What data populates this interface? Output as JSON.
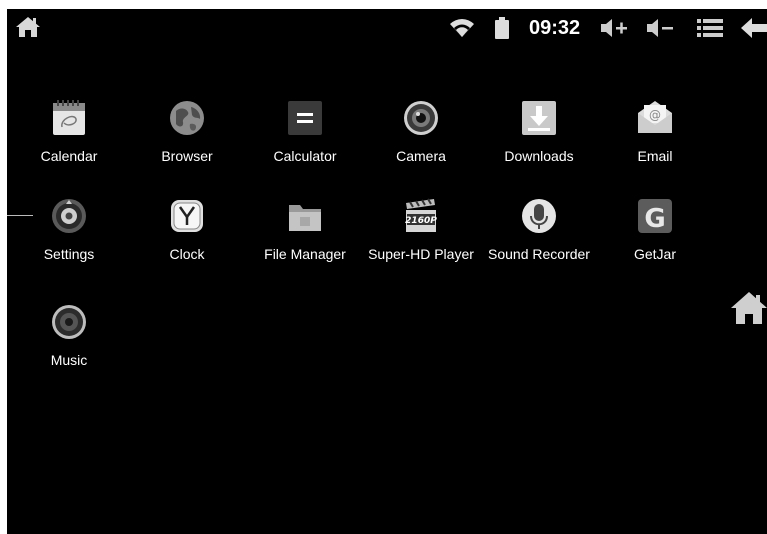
{
  "status_bar": {
    "time": "09:32",
    "icons": [
      "home-icon",
      "wifi-icon",
      "battery-icon",
      "volume-up-icon",
      "volume-down-icon",
      "menu-icon",
      "back-icon"
    ]
  },
  "apps": [
    {
      "label": "Calendar",
      "icon": "calendar-icon"
    },
    {
      "label": "Browser",
      "icon": "globe-icon"
    },
    {
      "label": "Calculator",
      "icon": "calculator-icon"
    },
    {
      "label": "Camera",
      "icon": "camera-icon"
    },
    {
      "label": "Downloads",
      "icon": "download-icon"
    },
    {
      "label": "Email",
      "icon": "email-icon"
    },
    {
      "label": "Settings",
      "icon": "gear-icon"
    },
    {
      "label": "Clock",
      "icon": "clock-icon"
    },
    {
      "label": "File Manager",
      "icon": "folder-icon"
    },
    {
      "label": "Super-HD Player",
      "icon": "clapperboard-icon",
      "badge": "2160P"
    },
    {
      "label": "Sound Recorder",
      "icon": "microphone-icon"
    },
    {
      "label": "GetJar",
      "icon": "getjar-icon",
      "glyph": "G"
    },
    {
      "label": "Music",
      "icon": "speaker-icon"
    }
  ],
  "side": {
    "icon": "home-icon"
  }
}
